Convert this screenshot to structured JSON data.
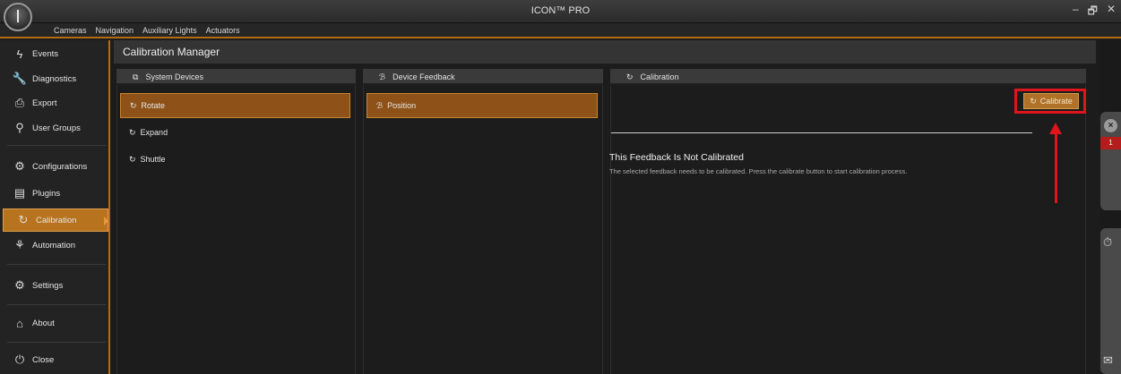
{
  "app": {
    "title": "ICON™ PRO"
  },
  "window": {
    "minimize": "–",
    "restore": "🗗",
    "close": "✕"
  },
  "menu": [
    "Cameras",
    "Navigation",
    "Auxiliary Lights",
    "Actuators"
  ],
  "sidebar": {
    "items": [
      {
        "label": "Events",
        "icon": "lightning-icon",
        "glyph": "ϟ"
      },
      {
        "label": "Diagnostics",
        "icon": "wrench-icon",
        "glyph": "🔧"
      },
      {
        "label": "Export",
        "icon": "export-icon",
        "glyph": "⎙"
      },
      {
        "label": "User Groups",
        "icon": "user-groups-icon",
        "glyph": "⚲"
      },
      {
        "label": "Configurations",
        "icon": "configurations-icon",
        "glyph": "⚙"
      },
      {
        "label": "Plugins",
        "icon": "plugins-icon",
        "glyph": "▤"
      },
      {
        "label": "Calibration",
        "icon": "calibration-icon",
        "glyph": "↻"
      },
      {
        "label": "Automation",
        "icon": "automation-icon",
        "glyph": "⚘"
      },
      {
        "label": "Settings",
        "icon": "settings-icon",
        "glyph": "⚙"
      },
      {
        "label": "About",
        "icon": "about-icon",
        "glyph": "⌂"
      },
      {
        "label": "Close",
        "icon": "power-icon",
        "glyph": "⏻"
      }
    ],
    "active": "Calibration"
  },
  "main": {
    "title": "Calibration Manager",
    "panels": {
      "system_devices": {
        "title": "System Devices",
        "icon": "devices-icon",
        "items": [
          "Rotate",
          "Expand",
          "Shuttle"
        ],
        "selected": "Rotate"
      },
      "device_feedback": {
        "title": "Device Feedback",
        "icon": "feedback-icon",
        "items": [
          "Position"
        ],
        "selected": "Position"
      },
      "calibration": {
        "title": "Calibration",
        "icon": "calibration-icon",
        "button": "Calibrate",
        "status_title": "This Feedback Is Not Calibrated",
        "status_desc": "The selected feedback needs to be calibrated. Press the calibrate button to start calibration process."
      }
    }
  },
  "rail": {
    "badge": "1"
  },
  "annotation": {
    "color": "#e0141c"
  },
  "colors": {
    "accent": "#b8731e",
    "selected": "#8e5218"
  }
}
